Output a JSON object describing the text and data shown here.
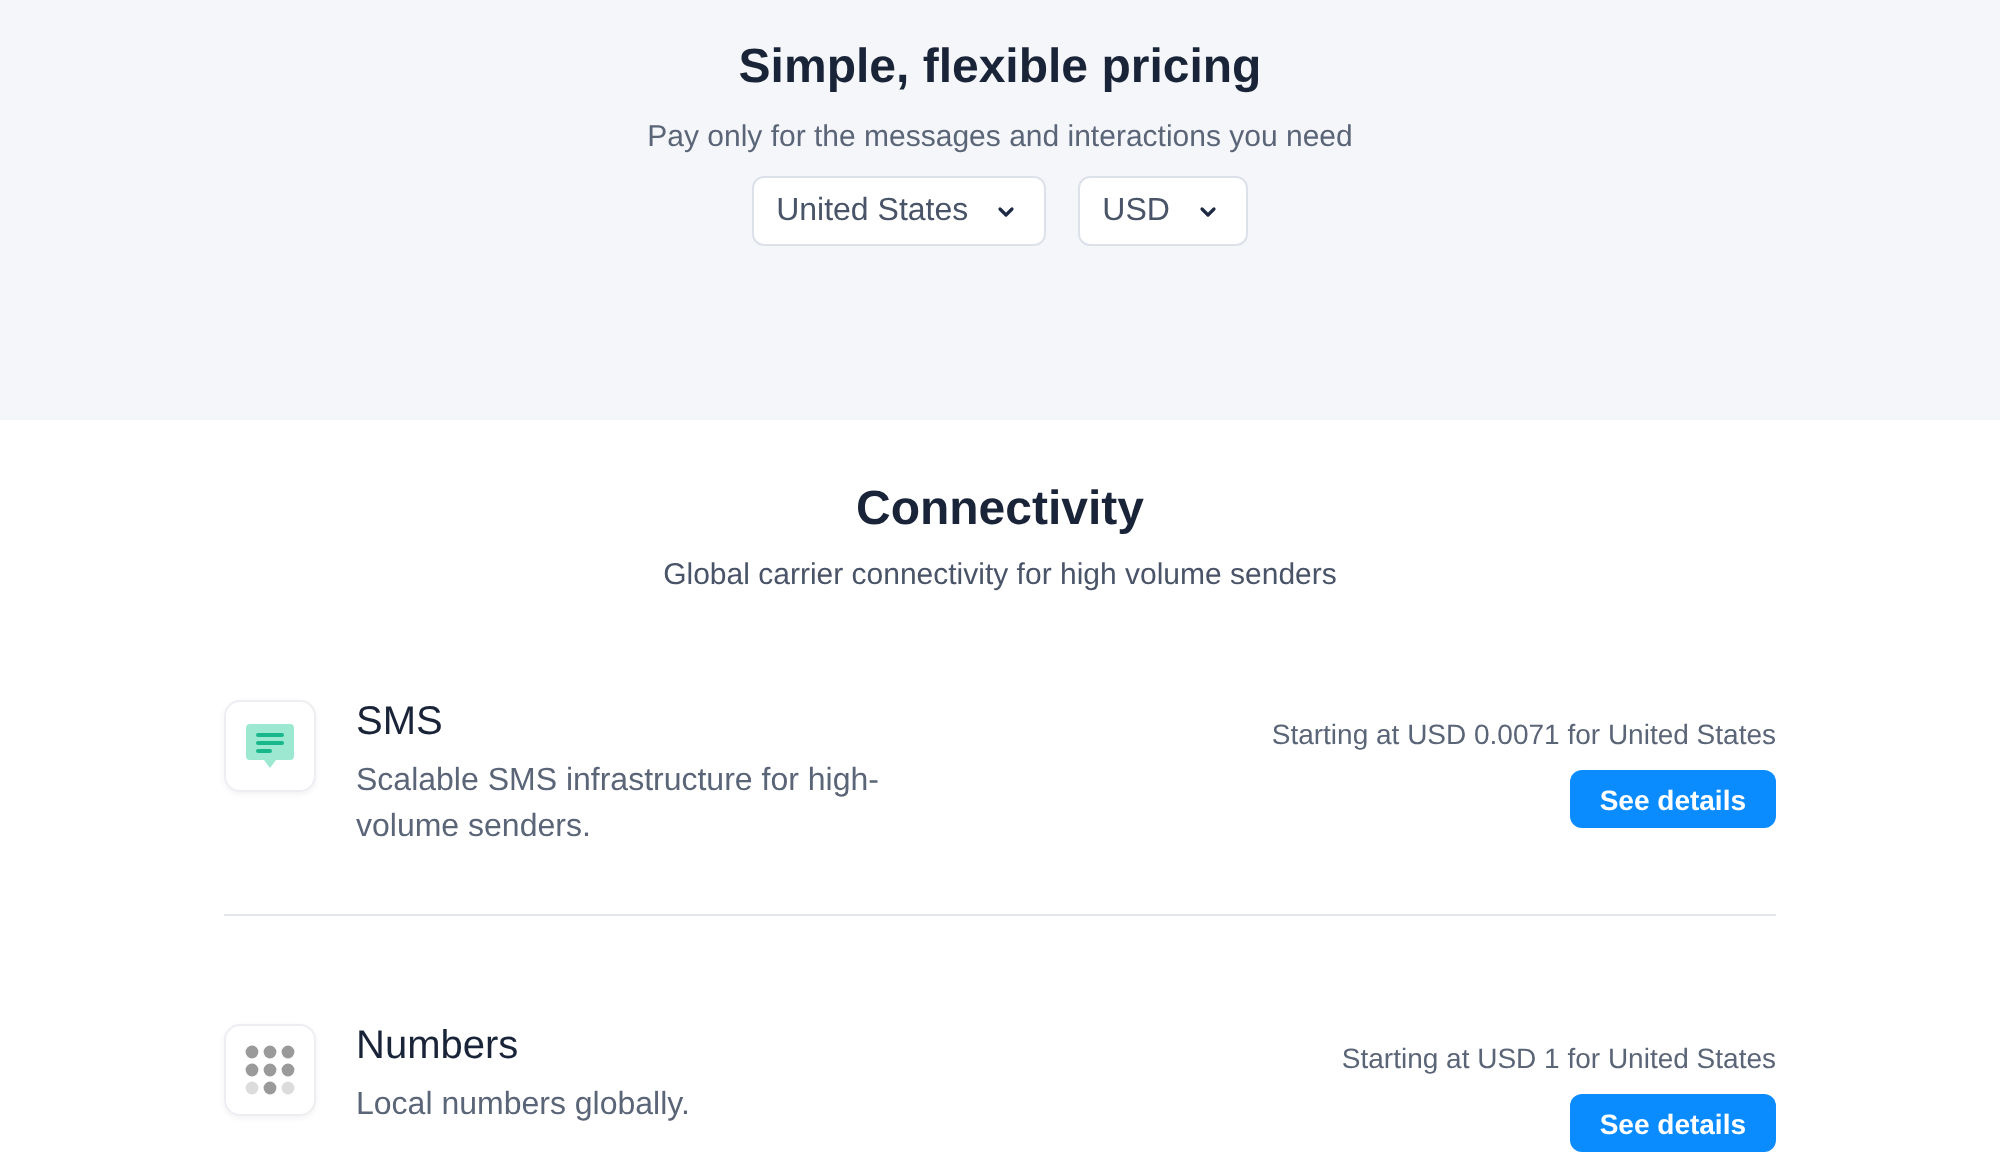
{
  "hero": {
    "title": "Simple, flexible pricing",
    "subtitle": "Pay only for the messages and interactions you need",
    "selects": [
      {
        "value": "United States"
      },
      {
        "value": "USD"
      }
    ]
  },
  "section": {
    "title": "Connectivity",
    "subtitle": "Global carrier connectivity for high volume senders",
    "products": [
      {
        "kind": "sms",
        "name": "SMS",
        "description": "Scalable SMS infrastructure for high-volume senders.",
        "price": "Starting at USD 0.0071 for United States",
        "button": "See details"
      },
      {
        "kind": "numbers",
        "name": "Numbers",
        "description": "Local numbers globally.",
        "price": "Starting at USD 1 for United States",
        "button": "See details"
      }
    ]
  }
}
